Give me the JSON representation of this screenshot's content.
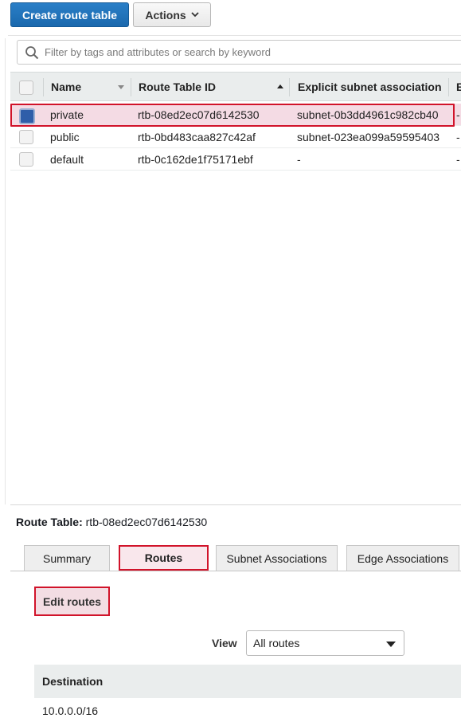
{
  "toolbar": {
    "create_label": "Create route table",
    "actions_label": "Actions"
  },
  "filter": {
    "placeholder": "Filter by tags and attributes or search by keyword"
  },
  "table": {
    "columns": {
      "name": "Name",
      "route_table_id": "Route Table ID",
      "explicit_subnet": "Explicit subnet association",
      "edge": "E"
    },
    "rows": [
      {
        "name": "private",
        "id": "rtb-08ed2ec07d6142530",
        "subnet": "subnet-0b3dd4961c982cb40",
        "edge": "-",
        "selected": true
      },
      {
        "name": "public",
        "id": "rtb-0bd483caa827c42af",
        "subnet": "subnet-023ea099a59595403",
        "edge": "-",
        "selected": false
      },
      {
        "name": "default",
        "id": "rtb-0c162de1f75171ebf",
        "subnet": "-",
        "edge": "-",
        "selected": false
      }
    ]
  },
  "details": {
    "title_label": "Route Table:",
    "title_value": "rtb-08ed2ec07d6142530",
    "tabs": [
      {
        "label": "Summary"
      },
      {
        "label": "Routes"
      },
      {
        "label": "Subnet Associations"
      },
      {
        "label": "Edge Associations"
      }
    ],
    "edit_routes_label": "Edit routes",
    "view_label": "View",
    "view_value": "All routes",
    "routes_header": "Destination",
    "routes_first_destination": "10.0.0.0/16"
  },
  "colors": {
    "primary": "#1f73b7",
    "highlight": "#d1132a",
    "selected_row": "#f4dbe4"
  }
}
